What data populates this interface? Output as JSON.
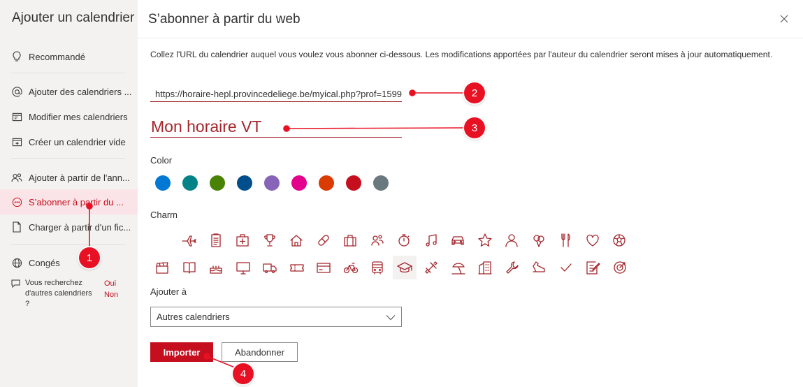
{
  "sidebar": {
    "title": "Ajouter un calendrier",
    "items": [
      {
        "label": "Recommandé",
        "icon": "lightbulb-icon"
      },
      {
        "label": "Ajouter des calendriers ...",
        "icon": "at-sign-icon"
      },
      {
        "label": "Modifier mes calendriers",
        "icon": "calendar-edit-icon"
      },
      {
        "label": "Créer un calendrier vide",
        "icon": "calendar-add-icon"
      },
      {
        "label": "Ajouter à partir de l'ann...",
        "icon": "people-icon"
      },
      {
        "label": "S’abonner à partir du ...",
        "icon": "subscribe-icon"
      },
      {
        "label": "Charger à partir d'un fic...",
        "icon": "document-upload-icon"
      },
      {
        "label": "Congés",
        "icon": "globe-icon"
      }
    ],
    "note": "Vous recherchez d'autres calendriers ?",
    "note_yes": "Oui",
    "note_no": "Non"
  },
  "dialog": {
    "title": "S’abonner à partir du web",
    "description": "Collez l'URL du calendrier auquel vous voulez vous abonner ci-dessous. Les modifications apportées par l'auteur du calendrier seront mises à jour automatiquement.",
    "url_value": "https://horaire-hepl.provincedeliege.be/myical.php?prof=1599",
    "name_value": "Mon horaire VT",
    "color_label": "Color",
    "colors": [
      "#0078d4",
      "#038387",
      "#498205",
      "#004e8c",
      "#8764b8",
      "#e3008c",
      "#da3b01",
      "#c50f1f",
      "#69797e"
    ],
    "charm_label": "Charm",
    "charms_row1": [
      "airplane-icon",
      "clipboard-icon",
      "first-aid-kit-icon",
      "trophy-icon",
      "home-icon",
      "pill-icon",
      "briefcase-icon",
      "people-icon",
      "stopwatch-icon",
      "music-note-icon",
      "car-icon",
      "star-icon",
      "person-icon",
      "balloons-icon",
      "fork-knife-icon",
      "heart-icon",
      "soccer-ball-icon"
    ],
    "charms_row2": [
      "clapperboard-icon",
      "book-icon",
      "cake-icon",
      "monitor-icon",
      "truck-icon",
      "ticket-icon",
      "credit-card-icon",
      "bicycle-icon",
      "bus-icon",
      "graduation-cap-icon",
      "dumbbell-icon",
      "beach-umbrella-icon",
      "buildings-icon",
      "wrench-icon",
      "sneaker-icon",
      "checkmark-icon",
      "notepad-edit-icon",
      "target-icon"
    ],
    "add_to_label": "Ajouter à",
    "add_to_value": "Autres calendriers",
    "import_button": "Importer",
    "cancel_button": "Abandonner"
  },
  "annotations": [
    "1",
    "2",
    "3",
    "4"
  ],
  "accent_color": "#c50f1f",
  "annotation_color": "#e81123"
}
